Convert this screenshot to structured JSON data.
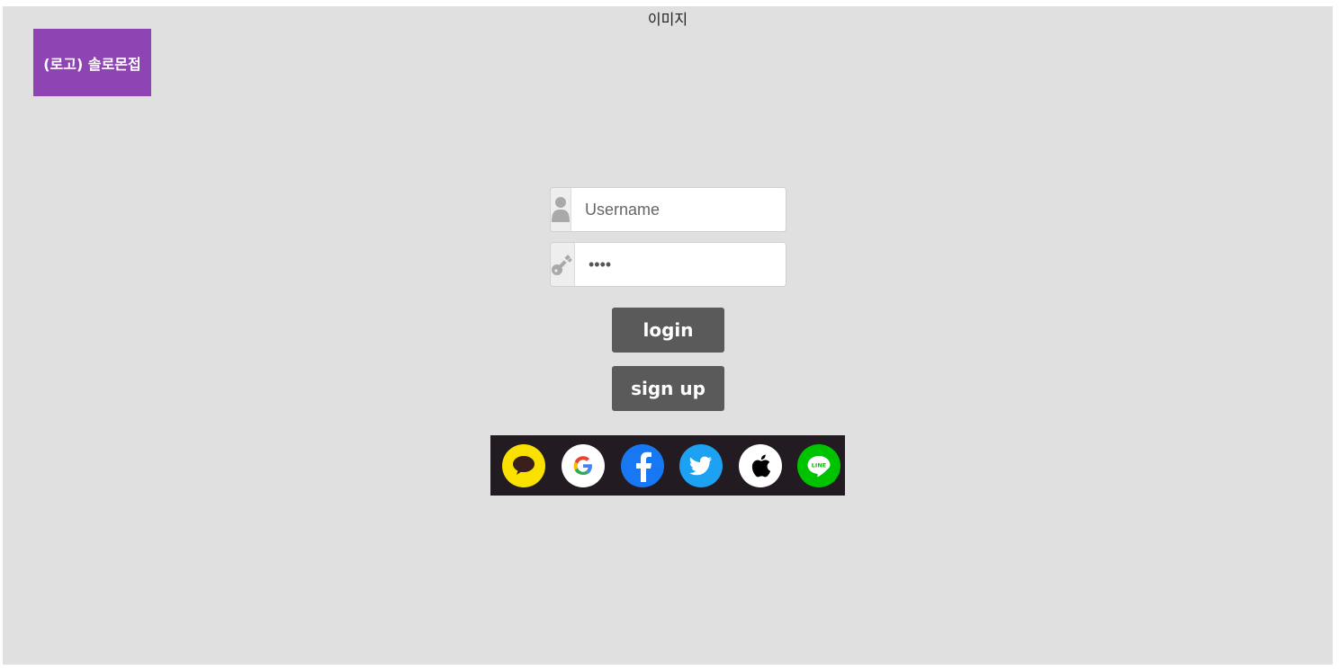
{
  "header": {
    "image_label": "이미지"
  },
  "logo": {
    "text": "(로고) 솔로몬접",
    "color": "#8e44b3"
  },
  "login_form": {
    "username_placeholder": "Username",
    "password_value": "••••",
    "login_label": "login",
    "signup_label": "sign up"
  },
  "social": {
    "items": [
      {
        "name": "kakao",
        "icon": "kakao-icon",
        "color": "#fae100"
      },
      {
        "name": "google",
        "icon": "google-icon",
        "color": "#ffffff"
      },
      {
        "name": "facebook",
        "icon": "facebook-icon",
        "color": "#1877f2"
      },
      {
        "name": "twitter",
        "icon": "twitter-icon",
        "color": "#1da1f2"
      },
      {
        "name": "apple",
        "icon": "apple-icon",
        "color": "#ffffff"
      },
      {
        "name": "line",
        "icon": "line-icon",
        "color": "#00c300"
      }
    ]
  },
  "colors": {
    "background": "#e0e0e0",
    "button": "#5a5a5a"
  }
}
